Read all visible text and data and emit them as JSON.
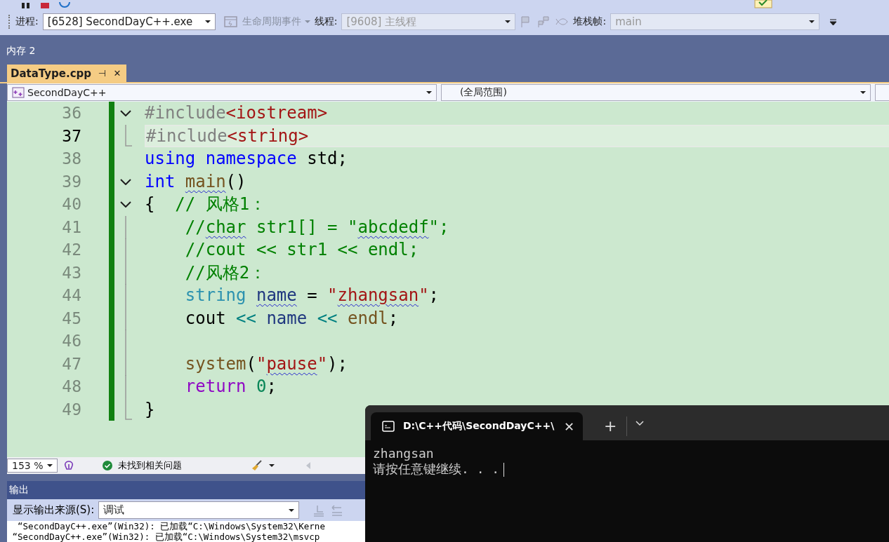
{
  "toolbar": {
    "process_label": "进程:",
    "process": {
      "value": "[6528] SecondDayC++.exe",
      "disabled": false
    },
    "lifecycle": {
      "label": "生命周期事件",
      "disabled": true
    },
    "thread_label": "线程:",
    "thread": {
      "value": "[9608] 主线程",
      "disabled": true
    },
    "stack_label": "堆栈帧:",
    "stack": {
      "value": "main",
      "disabled": true
    }
  },
  "panel_title": "内存 2",
  "document_tab": {
    "title": "DataType.cpp",
    "pin": "⊣",
    "close": "✕",
    "selected": true
  },
  "nav": {
    "project": "SecondDayC++",
    "scope": "(全局范围)"
  },
  "editor": {
    "lines": [
      {
        "number": "36",
        "current": false,
        "changed": true,
        "kind": "fold",
        "tokens": [
          {
            "text": "#include",
            "kind": "pre"
          },
          {
            "text": "<iostream>",
            "kind": "inc"
          }
        ]
      },
      {
        "number": "37",
        "current": true,
        "changed": true,
        "kind": "end",
        "tokens": [
          {
            "text": "#include",
            "kind": "pre"
          },
          {
            "text": "<string>",
            "kind": "inc"
          }
        ]
      },
      {
        "number": "38",
        "current": false,
        "changed": true,
        "kind": "plain",
        "tokens": [
          {
            "text": "using",
            "kind": "kw"
          },
          {
            "text": " namespace",
            "kind": "kw"
          },
          {
            "text": " std;",
            "kind": "plain"
          }
        ]
      },
      {
        "number": "39",
        "current": false,
        "changed": true,
        "kind": "fold",
        "tokens": [
          {
            "text": "int ",
            "kind": "kw"
          },
          {
            "text": "main",
            "kind": "func-error"
          },
          {
            "text": "()",
            "kind": "plain"
          }
        ]
      },
      {
        "number": "40",
        "current": false,
        "changed": true,
        "kind": "fold",
        "tokens": [
          {
            "text": "{",
            "kind": "plain"
          },
          {
            "text": "  // 风格1：",
            "kind": "comment"
          }
        ]
      },
      {
        "number": "41",
        "current": false,
        "changed": true,
        "kind": "body",
        "tokens": [
          {
            "text": "    //",
            "kind": "comment"
          },
          {
            "text": "char",
            "kind": "comment-error"
          },
          {
            "text": " str1[] = \"",
            "kind": "comment"
          },
          {
            "text": "abcdedf",
            "kind": "comment-error"
          },
          {
            "text": "\";",
            "kind": "comment"
          }
        ]
      },
      {
        "number": "42",
        "current": false,
        "changed": true,
        "kind": "body",
        "tokens": [
          {
            "text": "    //cout << str1 << endl;",
            "kind": "comment"
          }
        ]
      },
      {
        "number": "43",
        "current": false,
        "changed": true,
        "kind": "body",
        "tokens": [
          {
            "text": "    //风格2：",
            "kind": "comment"
          }
        ]
      },
      {
        "number": "44",
        "current": false,
        "changed": true,
        "kind": "body",
        "tokens": [
          {
            "text": "    string ",
            "kind": "type"
          },
          {
            "text": "name",
            "kind": "var-error"
          },
          {
            "text": " = ",
            "kind": "plain"
          },
          {
            "text": "\"",
            "kind": "str"
          },
          {
            "text": "zhangsan",
            "kind": "str-error"
          },
          {
            "text": "\"",
            "kind": "str"
          },
          {
            "text": ";",
            "kind": "plain"
          }
        ]
      },
      {
        "number": "45",
        "current": false,
        "changed": true,
        "kind": "body",
        "tokens": [
          {
            "text": "    cout ",
            "kind": "plain"
          },
          {
            "text": "<< ",
            "kind": "op"
          },
          {
            "text": "name ",
            "kind": "var"
          },
          {
            "text": "<< ",
            "kind": "op"
          },
          {
            "text": "endl",
            "kind": "func"
          },
          {
            "text": ";",
            "kind": "plain"
          }
        ]
      },
      {
        "number": "46",
        "current": false,
        "changed": true,
        "kind": "body"
      },
      {
        "number": "47",
        "current": false,
        "changed": true,
        "kind": "body",
        "tokens": [
          {
            "text": "    system",
            "kind": "func"
          },
          {
            "text": "(",
            "kind": "plain"
          },
          {
            "text": "\"",
            "kind": "str"
          },
          {
            "text": "pause",
            "kind": "str-error"
          },
          {
            "text": "\"",
            "kind": "str"
          },
          {
            "text": ");",
            "kind": "plain"
          }
        ]
      },
      {
        "number": "48",
        "current": false,
        "changed": true,
        "kind": "body",
        "tokens": [
          {
            "text": "    return",
            "kind": "ctrl"
          },
          {
            "text": " 0",
            "kind": "num"
          },
          {
            "text": ";",
            "kind": "plain"
          }
        ]
      },
      {
        "number": "49",
        "current": false,
        "changed": true,
        "kind": "end",
        "tokens": [
          {
            "text": "}",
            "kind": "plain"
          }
        ]
      }
    ]
  },
  "status_bar": {
    "zoom": "153 %",
    "issues": "未找到相关问题"
  },
  "output": {
    "title": "输出",
    "source_label": "显示输出来源(S):",
    "source": "调试",
    "lines": [
      "  “SecondDayC++.exe”(Win32): 已加载“C:\\Windows\\System32\\Kerne",
      " “SecondDayC++.exe”(Win32): 已加载“C:\\Windows\\System32\\msvcp"
    ]
  },
  "terminal": {
    "tab_title": "D:\\C++代码\\SecondDayC++\\",
    "close": "✕",
    "new_tab": "+",
    "lines": [
      "zhangsan",
      "请按任意键继续. . ."
    ]
  }
}
